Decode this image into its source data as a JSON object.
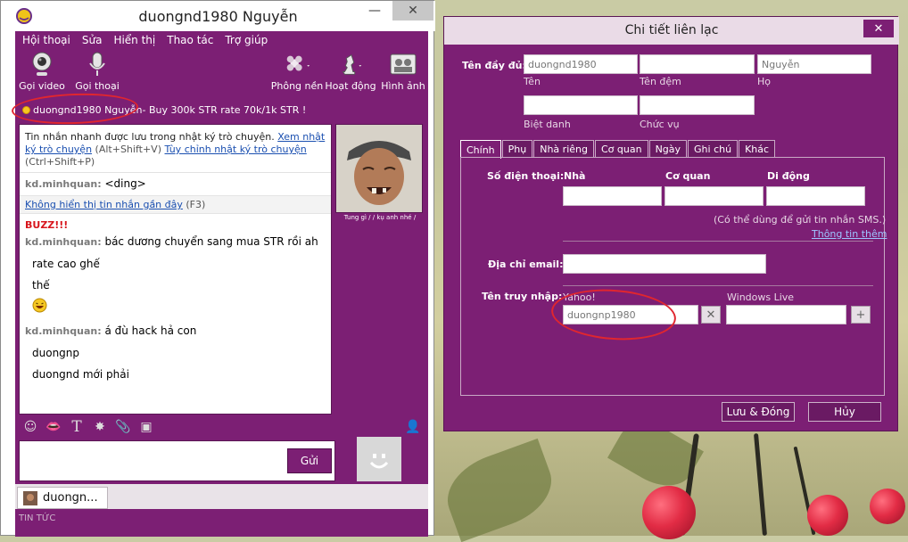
{
  "chat": {
    "title": "duongnd1980 Nguyễn",
    "menu": [
      "Hội thoại",
      "Sửa",
      "Hiển thị",
      "Thao tác",
      "Trợ giúp"
    ],
    "toolbar": {
      "video": "Gọi video",
      "voice": "Gọi thoại",
      "background": "Phông nền",
      "activities": "Hoạt động",
      "photos": "Hình ảnh"
    },
    "status_name": "duongnd1980 Nguyễn",
    "status_message": " -  Buy 300k STR rate 70k/1k STR !",
    "notice_text": "Tin nhắn nhanh được lưu trong nhật ký trò chuyện.",
    "notice_link1": "Xem nhật ký trò chuyện",
    "notice_shortcut1": "(Alt+Shift+V)",
    "notice_link2": "Tùy chỉnh nhật ký trò chuyện",
    "notice_shortcut2": "(Ctrl+Shift+P)",
    "msg1_sender": "kd.minhquan:",
    "msg1_text": "<ding>",
    "hide_recent_link": "Không hiển thị tin nhắn gần đây",
    "hide_recent_key": "(F3)",
    "buzz": "BUZZ!!!",
    "msg2_sender": "kd.minhquan:",
    "msg2_text": "bác dương chuyển sang mua STR rồi ah",
    "msg2_line2": "rate cao ghế",
    "msg2_line3": "thế",
    "msg3_sender": "kd.minhquan:",
    "msg3_text": "á đù hack hả con",
    "msg4": "duongnp",
    "msg5": "duongnd mới phải",
    "avatar_caption": "Tung gì / / kụ anh nhé /",
    "send": "Gửi",
    "conv_tab": "duongn...",
    "news": "TIN TỨC"
  },
  "dialog": {
    "title": "Chi tiết liên lạc",
    "full_name_label": "Tên đầy đủ:",
    "first_name_value": "duongnd1980",
    "last_name_value": "Nguyễn",
    "first_name_label": "Tên",
    "middle_name_label": "Tên đệm",
    "last_name_label": "Họ",
    "nickname_label": "Biệt danh",
    "title_label": "Chức vụ",
    "tabs": [
      "Chính",
      "Phụ",
      "Nhà riêng",
      "Cơ quan",
      "Ngày",
      "Ghi chú",
      "Khác"
    ],
    "phone_label": "Số điện thoại:",
    "phone_home": "Nhà",
    "phone_work": "Cơ quan",
    "phone_mobile": "Di động",
    "sms_note": "(Có thể dùng để gửi tin nhắn SMS.)",
    "more_info": "Thông tin thêm",
    "email_label": "Địa chỉ email:",
    "login_label": "Tên truy nhập:",
    "yahoo_label": "Yahoo!",
    "yahoo_value": "duongnp1980",
    "windows_live_label": "Windows Live",
    "save_close": "Lưu & Đóng",
    "cancel": "Hủy"
  },
  "colors": {
    "accent": "#7c1f74",
    "annotation": "#e0262f",
    "link": "#1a4fb0"
  }
}
